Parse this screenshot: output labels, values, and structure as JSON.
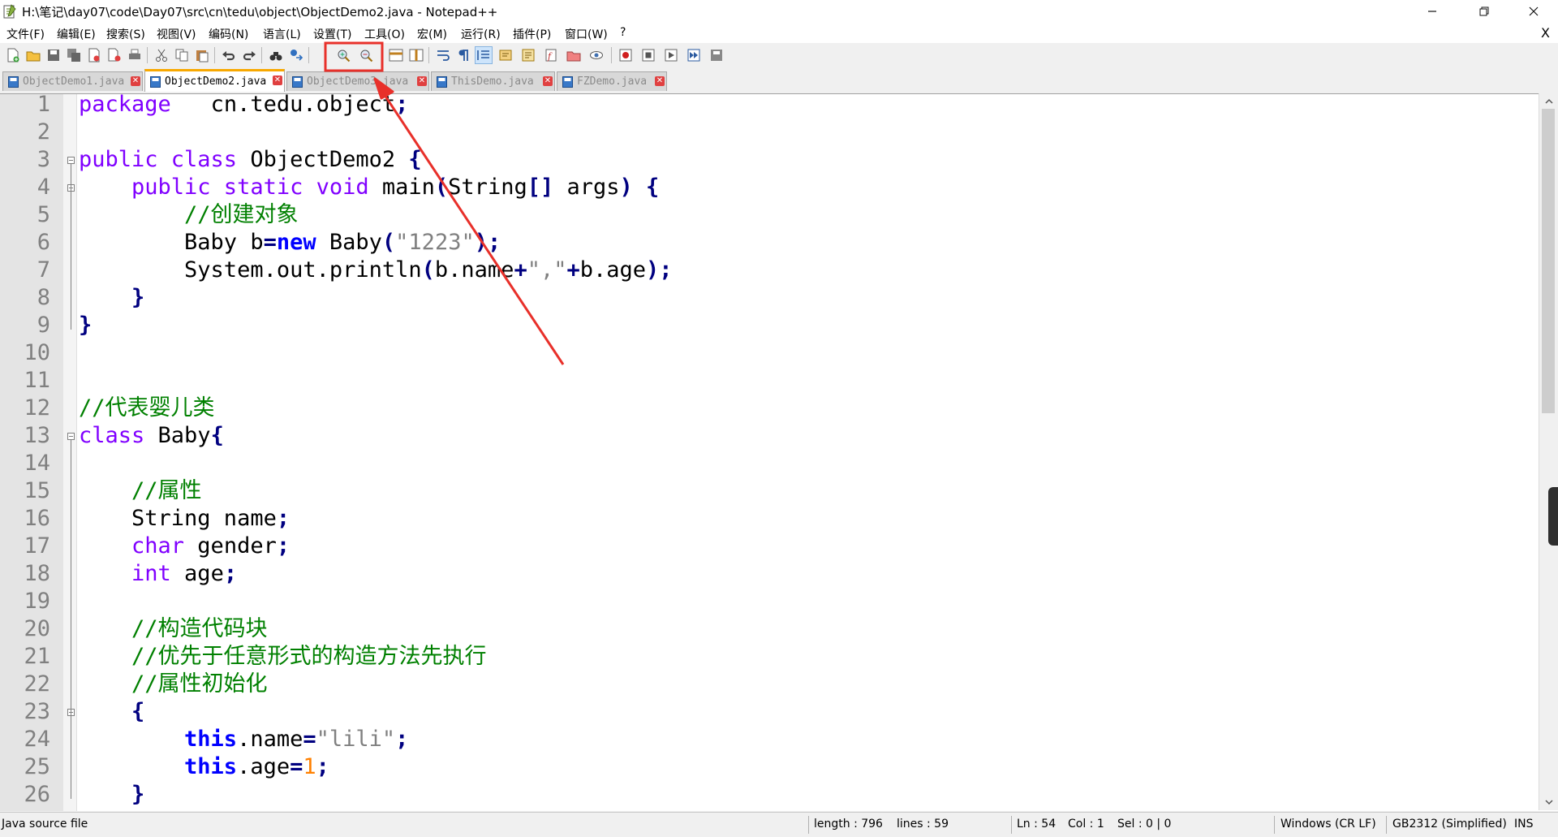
{
  "window": {
    "title": "H:\\笔记\\day07\\code\\Day07\\src\\cn\\tedu\\object\\ObjectDemo2.java - Notepad++",
    "minimize_icon": "minimize-icon",
    "restore_icon": "restore-icon",
    "close_icon": "close-icon"
  },
  "menu": {
    "items": [
      "文件(F)",
      "编辑(E)",
      "搜索(S)",
      "视图(V)",
      "编码(N)",
      "语言(L)",
      "设置(T)",
      "工具(O)",
      "宏(M)",
      "运行(R)",
      "插件(P)",
      "窗口(W)",
      "?"
    ],
    "close_label": "X"
  },
  "toolbar": {
    "buttons": [
      "new-file",
      "open-file",
      "save",
      "save-all",
      "close",
      "close-all",
      "print",
      "cut",
      "copy",
      "paste",
      "undo",
      "redo",
      "find",
      "replace",
      "zoom-in",
      "zoom-out",
      "sync-vertical",
      "sync-horizontal",
      "word-wrap",
      "show-all-chars",
      "indent-guide",
      "language-udl",
      "document-map",
      "function-list",
      "folder-as-workspace",
      "monitoring",
      "record-macro",
      "stop-record",
      "play-macro",
      "run-macro-multiple",
      "save-macro"
    ]
  },
  "tabs": [
    {
      "label": "ObjectDemo1.java",
      "active": false
    },
    {
      "label": "ObjectDemo2.java",
      "active": true
    },
    {
      "label": "ObjectDemo3.java",
      "active": false
    },
    {
      "label": "ThisDemo.java",
      "active": false
    },
    {
      "label": "FZDemo.java",
      "active": false
    }
  ],
  "editor": {
    "line_numbers": [
      "1",
      "2",
      "3",
      "4",
      "5",
      "6",
      "7",
      "8",
      "9",
      "10",
      "11",
      "12",
      "13",
      "14",
      "15",
      "16",
      "17",
      "18",
      "19",
      "20",
      "21",
      "22",
      "23",
      "24",
      "25",
      "26"
    ],
    "lines": [
      [
        [
          "kw",
          "package"
        ],
        [
          "",
          "   cn.tedu.object"
        ],
        [
          "op",
          ";"
        ]
      ],
      [],
      [
        [
          "kw",
          "public class"
        ],
        [
          "",
          " ObjectDemo2 "
        ],
        [
          "op",
          "{"
        ]
      ],
      [
        [
          "",
          ""
        ],
        [
          "kw",
          "    public static void"
        ],
        [
          "",
          " main"
        ],
        [
          "op",
          "("
        ],
        [
          "",
          "String"
        ],
        [
          "op",
          "[]"
        ],
        [
          "",
          " args"
        ],
        [
          "op",
          ")"
        ],
        [
          "",
          " "
        ],
        [
          "op",
          "{"
        ]
      ],
      [
        [
          "cm",
          "        //创建对象"
        ]
      ],
      [
        [
          "",
          "        Baby b"
        ],
        [
          "op",
          "="
        ],
        [
          "kwb",
          "new"
        ],
        [
          "",
          " Baby"
        ],
        [
          "op",
          "("
        ],
        [
          "st",
          "\"1223\""
        ],
        [
          "op",
          ");"
        ]
      ],
      [
        [
          "",
          "        System.out.println"
        ],
        [
          "op",
          "("
        ],
        [
          "",
          "b.name"
        ],
        [
          "op",
          "+"
        ],
        [
          "st",
          "\",\""
        ],
        [
          "op",
          "+"
        ],
        [
          "",
          "b.age"
        ],
        [
          "op",
          ");"
        ]
      ],
      [
        [
          "op",
          "    }"
        ]
      ],
      [
        [
          "op",
          "}"
        ]
      ],
      [],
      [],
      [
        [
          "cm",
          "//代表婴儿类"
        ]
      ],
      [
        [
          "kw",
          "class"
        ],
        [
          "",
          " Baby"
        ],
        [
          "op",
          "{"
        ]
      ],
      [],
      [
        [
          "cm",
          "    //属性"
        ]
      ],
      [
        [
          "",
          "    String name"
        ],
        [
          "op",
          ";"
        ]
      ],
      [
        [
          "kw",
          "    char"
        ],
        [
          "",
          " gender"
        ],
        [
          "op",
          ";"
        ]
      ],
      [
        [
          "kw",
          "    int"
        ],
        [
          "",
          " age"
        ],
        [
          "op",
          ";"
        ]
      ],
      [],
      [
        [
          "cm",
          "    //构造代码块"
        ]
      ],
      [
        [
          "cm",
          "    //优先于任意形式的构造方法先执行"
        ]
      ],
      [
        [
          "cm",
          "    //属性初始化"
        ]
      ],
      [
        [
          "op",
          "    {"
        ]
      ],
      [
        [
          "kwb",
          "        this"
        ],
        [
          "",
          ".name"
        ],
        [
          "op",
          "="
        ],
        [
          "st",
          "\"lili\""
        ],
        [
          "op",
          ";"
        ]
      ],
      [
        [
          "kwb",
          "        this"
        ],
        [
          "",
          ".age"
        ],
        [
          "op",
          "="
        ],
        [
          "nm",
          "1"
        ],
        [
          "op",
          ";"
        ]
      ],
      [
        [
          "op",
          "    }"
        ]
      ]
    ]
  },
  "status": {
    "file_type": "Java source file",
    "length": "length : 796",
    "lines": "lines : 59",
    "ln": "Ln : 54",
    "col": "Col : 1",
    "sel": "Sel : 0 | 0",
    "eol": "Windows (CR LF)",
    "encoding": "GB2312 (Simplified)",
    "mode": "INS"
  },
  "colors": {
    "keyword": "#8000ff",
    "keyword_bold": "#0000ff",
    "comment": "#008000",
    "string": "#808080",
    "number": "#ff8000",
    "annotation": "#e8302a",
    "tab_active_accent": "#f8a800"
  }
}
